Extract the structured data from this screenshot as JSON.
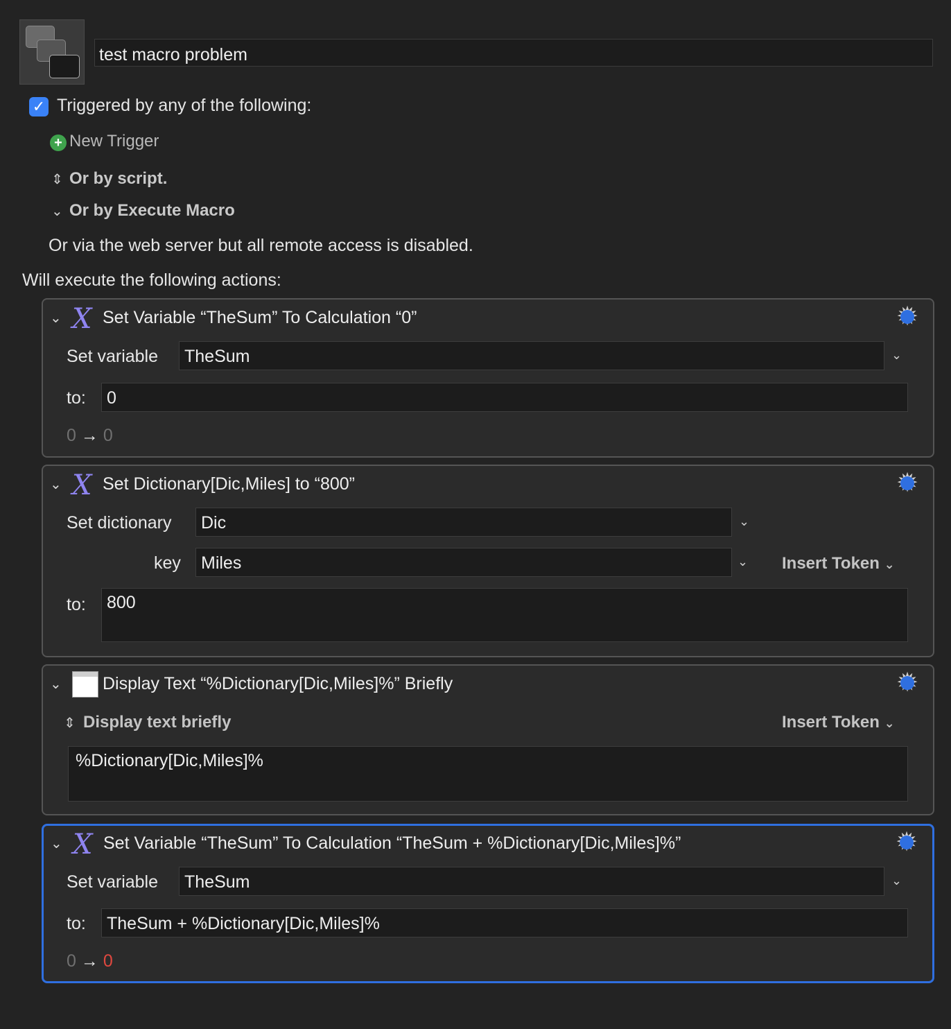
{
  "header": {
    "macro_name": "test macro problem",
    "triggered_label": "Triggered by any of the following:",
    "new_trigger_label": "New Trigger",
    "or_by_script": "Or by script.",
    "or_by_execute_macro": "Or by Execute Macro",
    "web_server_note": "Or via the web server but all remote access is disabled.",
    "will_execute": "Will execute the following actions:"
  },
  "actions": [
    {
      "title": "Set Variable “TheSum” To Calculation “0”",
      "set_label": "Set variable",
      "variable": "TheSum",
      "to_label": "to:",
      "calculation": "0",
      "result_in": "0",
      "result_arrow": "→",
      "result_out": "0"
    },
    {
      "title": "Set Dictionary[Dic,Miles] to “800”",
      "set_label": "Set dictionary",
      "dictionary": "Dic",
      "key_label": "key",
      "key": "Miles",
      "insert_token": "Insert Token",
      "to_label": "to:",
      "value": "800"
    },
    {
      "title": "Display Text “%Dictionary[Dic,Miles]%” Briefly",
      "mode": "Display text briefly",
      "insert_token": "Insert Token",
      "text": "%Dictionary[Dic,Miles]%"
    },
    {
      "title": "Set Variable “TheSum” To Calculation “TheSum + %Dictionary[Dic,Miles]%”",
      "set_label": "Set variable",
      "variable": "TheSum",
      "to_label": "to:",
      "calculation": "TheSum + %Dictionary[Dic,Miles]%",
      "result_in": "0",
      "result_arrow": "→",
      "result_out": "0"
    }
  ],
  "colors": {
    "background": "#232323",
    "accent_blue": "#2f6fe0",
    "checkbox_blue": "#3a82f7",
    "plus_green": "#3fa34d",
    "error_red": "#e0483f",
    "variable_icon_purple": "#8f84f0"
  },
  "icons": [
    "macro-icon",
    "checkbox-checked-icon",
    "plus-circle-icon",
    "updown-chevron-icon",
    "chevron-down-icon",
    "variable-x-icon",
    "gear-icon",
    "display-text-icon"
  ]
}
